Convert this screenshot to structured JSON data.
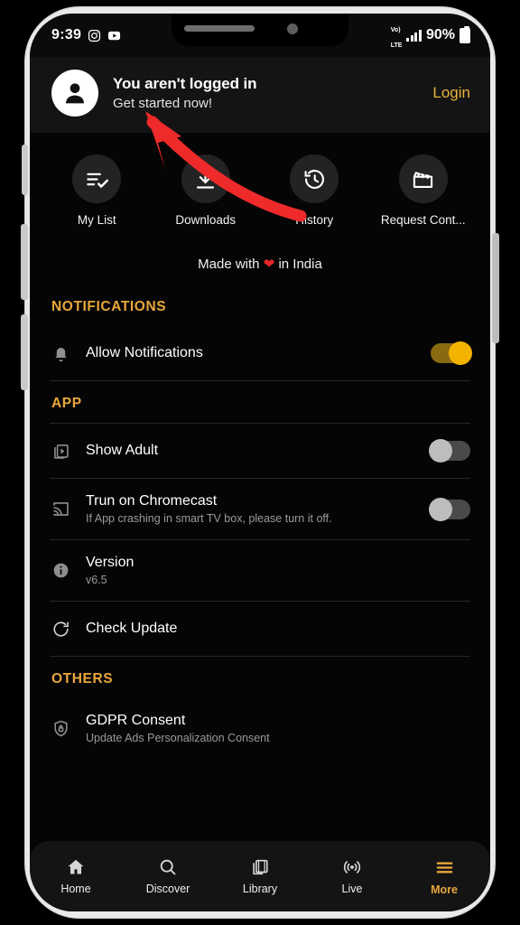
{
  "status_bar": {
    "time": "9:39",
    "app_icons": [
      "instagram-icon",
      "youtube-icon"
    ],
    "network_label": "VoLTE",
    "network_line1": "Vo)",
    "network_line2": "LTE",
    "signal_bars": 3,
    "battery_percent": "90%"
  },
  "login_banner": {
    "avatar_icon": "person-avatar-icon",
    "title": "You aren't logged in",
    "subtitle": "Get started now!",
    "action_label": "Login",
    "accent_color": "#e9b23c"
  },
  "quick_actions": [
    {
      "label": "My List",
      "icon": "playlist-check-icon"
    },
    {
      "label": "Downloads",
      "icon": "download-icon"
    },
    {
      "label": "History",
      "icon": "history-clock-icon"
    },
    {
      "label": "Request Cont...",
      "icon": "clapperboard-icon"
    }
  ],
  "made_with": {
    "prefix": "Made with",
    "heart": "❤",
    "suffix": "in India"
  },
  "sections": [
    {
      "title": "NOTIFICATIONS",
      "rows": [
        {
          "icon": "bell-icon",
          "title": "Allow Notifications",
          "subtitle": "",
          "control": "toggle",
          "state": "on"
        }
      ]
    },
    {
      "title": "APP",
      "rows": [
        {
          "icon": "video-library-icon",
          "title": "Show Adult",
          "subtitle": "",
          "control": "toggle",
          "state": "off"
        },
        {
          "icon": "chromecast-icon",
          "title": "Trun on Chromecast",
          "subtitle": "If App crashing in smart TV box, please turn it off.",
          "control": "toggle",
          "state": "off"
        },
        {
          "icon": "info-icon",
          "title": "Version",
          "subtitle": "v6.5",
          "control": "none",
          "state": ""
        },
        {
          "icon": "refresh-icon",
          "title": "Check Update",
          "subtitle": "",
          "control": "none",
          "state": ""
        }
      ]
    },
    {
      "title": "OTHERS",
      "rows": [
        {
          "icon": "shield-lock-icon",
          "title": "GDPR Consent",
          "subtitle": "Update Ads Personalization Consent",
          "control": "none",
          "state": ""
        }
      ]
    }
  ],
  "bottom_nav": {
    "active": "More",
    "active_color": "#e9a73c",
    "items": [
      {
        "label": "Home",
        "icon": "home-icon"
      },
      {
        "label": "Discover",
        "icon": "search-icon"
      },
      {
        "label": "Library",
        "icon": "film-stack-icon"
      },
      {
        "label": "Live",
        "icon": "broadcast-icon"
      },
      {
        "label": "More",
        "icon": "hamburger-icon"
      }
    ]
  },
  "annotation": {
    "type": "arrow",
    "color": "#ef2a2a",
    "points_to": "Get started now!"
  }
}
